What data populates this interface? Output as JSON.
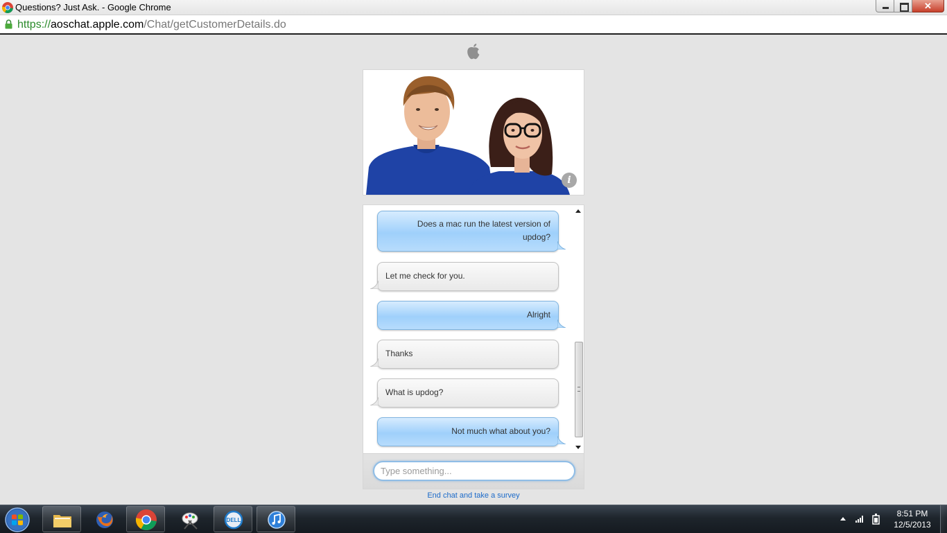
{
  "window": {
    "title": "Questions? Just Ask. - Google Chrome"
  },
  "address_bar": {
    "scheme": "https://",
    "host": "aoschat.apple.com",
    "path": "/Chat/getCustomerDetails.do"
  },
  "hero": {
    "info_label": "i"
  },
  "chat": {
    "messages": [
      {
        "sender": "user",
        "lines": [
          "Does a mac run the latest version of",
          "updog?"
        ]
      },
      {
        "sender": "agent",
        "lines": [
          "Let me check for you."
        ]
      },
      {
        "sender": "user",
        "lines": [
          "Alright"
        ]
      },
      {
        "sender": "agent",
        "lines": [
          "Thanks"
        ]
      },
      {
        "sender": "agent",
        "lines": [
          "What is updog?"
        ]
      },
      {
        "sender": "user",
        "lines": [
          "Not much what about you?"
        ]
      }
    ],
    "input_placeholder": "Type something...",
    "end_link": "End chat and take a survey"
  },
  "taskbar": {
    "items": [
      {
        "name": "file-explorer",
        "icon": "folder-icon"
      },
      {
        "name": "firefox",
        "icon": "firefox-icon"
      },
      {
        "name": "chrome",
        "icon": "chrome-icon"
      },
      {
        "name": "paint",
        "icon": "paint-icon"
      },
      {
        "name": "dell",
        "icon": "dell-icon"
      },
      {
        "name": "itunes",
        "icon": "itunes-icon"
      }
    ],
    "clock_time": "8:51 PM",
    "clock_date": "12/5/2013"
  },
  "colors": {
    "user_bubble": "#9fd0fb",
    "agent_bubble": "#e9e9e9",
    "link": "#1b6ac9",
    "url_scheme": "#2a8a2a"
  }
}
